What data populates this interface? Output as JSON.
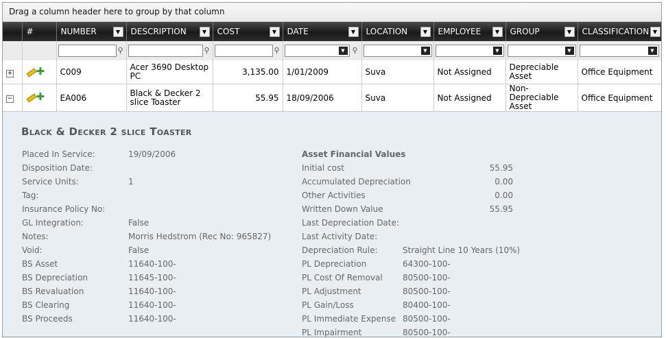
{
  "group_panel": {
    "text": "Drag a column header here to group by that column"
  },
  "columns": [
    "#",
    "NUMBER",
    "DESCRIPTION",
    "COST",
    "DATE",
    "LOCATION",
    "EMPLOYEE",
    "GROUP",
    "CLASSIFICATION"
  ],
  "rows": [
    {
      "expander": "+",
      "number": "C009",
      "description": "Acer 3690 Desktop PC",
      "cost": "3,135.00",
      "date": "1/01/2009",
      "location": "Suva",
      "employee": "Not Assigned",
      "group": "Depreciable Asset",
      "classification": "Office Equipment"
    },
    {
      "expander": "−",
      "number": "EA006",
      "description": "Black & Decker 2 slice Toaster",
      "cost": "55.95",
      "date": "18/09/2006",
      "location": "Suva",
      "employee": "Not Assigned",
      "group": "Non-Depreciable Asset",
      "classification": "Office Equipment"
    }
  ],
  "detail": {
    "title": "Black & Decker 2 slice Toaster",
    "left": [
      {
        "label": "Placed In Service:",
        "value": "19/09/2006"
      },
      {
        "label": "Disposition Date:",
        "value": ""
      },
      {
        "label": "Service Units:",
        "value": "1"
      },
      {
        "label": "Tag:",
        "value": ""
      },
      {
        "label": "Insurance Policy No:",
        "value": ""
      },
      {
        "label": "GL Integration:",
        "value": "False"
      },
      {
        "label": "Notes:",
        "value": "Morris Hedstrom (Rec No: 965827)"
      },
      {
        "label": "Void:",
        "value": "False"
      },
      {
        "label": "BS Asset",
        "value": "11640-100-"
      },
      {
        "label": "BS Depreciation",
        "value": "11645-100-"
      },
      {
        "label": "BS Revaluation",
        "value": "11640-100-"
      },
      {
        "label": "BS Clearing",
        "value": "11640-100-"
      },
      {
        "label": "BS Proceeds",
        "value": "11640-100-"
      }
    ],
    "financial_heading": "Asset Financial Values",
    "financial": [
      {
        "label": "Initial cost",
        "value": "55.95"
      },
      {
        "label": "Accumulated Depreciation",
        "value": "0.00"
      },
      {
        "label": "Other Activities",
        "value": "0.00"
      },
      {
        "label": "Written Down Value",
        "value": "55.95"
      }
    ],
    "right": [
      {
        "label": "Last Depreciation Date:",
        "value": ""
      },
      {
        "label": "Last Activity Date:",
        "value": ""
      },
      {
        "label": "Depreciation Rule:",
        "value": "Straight Line 10 Years (10%)"
      },
      {
        "label": "PL Depreciation",
        "value": "64300-100-"
      },
      {
        "label": "PL Cost Of Removal",
        "value": "80500-100-"
      },
      {
        "label": "PL Adjustment",
        "value": "80500-100-"
      },
      {
        "label": "PL Gain/Loss",
        "value": "80400-100-"
      },
      {
        "label": "PL Immediate Expense",
        "value": "80500-100-"
      },
      {
        "label": "PL Impairment",
        "value": "80500-100-"
      }
    ]
  }
}
